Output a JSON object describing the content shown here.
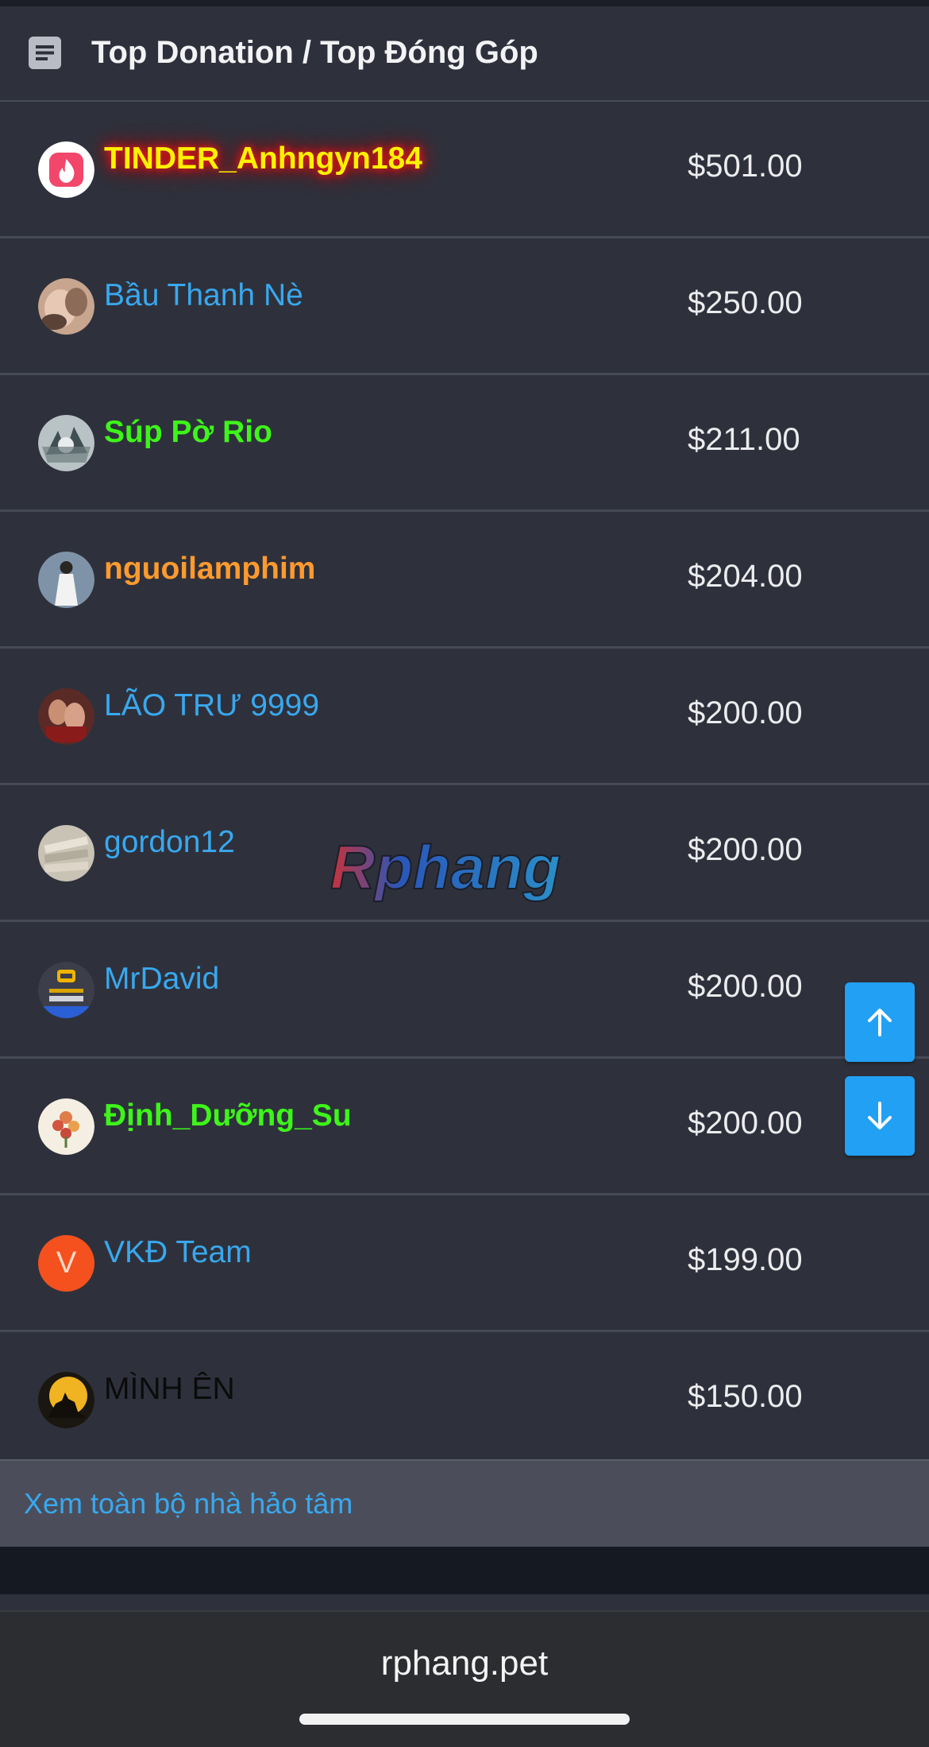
{
  "header": {
    "title": "Top Donation / Top Đóng Góp",
    "icon": "document-list-icon"
  },
  "donors": [
    {
      "name": "TINDER_Anhngyn184",
      "amount": "$501.00",
      "style": "yellow",
      "avatar": "tinder-logo-avatar"
    },
    {
      "name": "Bầu Thanh Nè",
      "amount": "$250.00",
      "style": "blue",
      "avatar": "photo-avatar"
    },
    {
      "name": "Súp Pờ Rio",
      "amount": "$211.00",
      "style": "green",
      "avatar": "photo-avatar"
    },
    {
      "name": "nguoilamphim",
      "amount": "$204.00",
      "style": "orange",
      "avatar": "photo-avatar"
    },
    {
      "name": "LÃO TRƯ 9999",
      "amount": "$200.00",
      "style": "blue",
      "avatar": "photo-avatar"
    },
    {
      "name": "gordon12",
      "amount": "$200.00",
      "style": "blue",
      "avatar": "photo-avatar"
    },
    {
      "name": "MrDavid",
      "amount": "$200.00",
      "style": "blue",
      "avatar": "banned-badge-avatar"
    },
    {
      "name": "Định_Dưỡng_Su",
      "amount": "$200.00",
      "style": "green",
      "avatar": "floral-avatar"
    },
    {
      "name": "VKĐ Team",
      "amount": "$199.00",
      "style": "blue",
      "avatar": "letter-avatar",
      "avatar_letter": "V"
    },
    {
      "name": "MÌNH ÊN",
      "amount": "$150.00",
      "style": "black",
      "avatar": "wolf-moon-avatar"
    }
  ],
  "footer": {
    "view_all_label": "Xem toàn bộ nhà hảo tâm"
  },
  "browser": {
    "url": "rphang.pet"
  },
  "controls": {
    "scroll_up_icon": "arrow-up-icon",
    "scroll_down_icon": "arrow-down-icon"
  },
  "watermark": {
    "text": "Rphang"
  },
  "colors": {
    "background": "#2e313c",
    "link_blue": "#39a8ee",
    "fab_blue": "#22a0f3",
    "name_green": "#3ef51a",
    "name_orange": "#ff9a2e",
    "name_yellow": "#fff200"
  }
}
